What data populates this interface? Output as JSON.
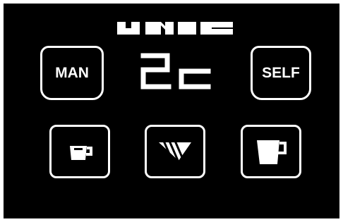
{
  "brand": {
    "logo_text": "UNIC"
  },
  "display": {
    "value": "2c"
  },
  "keys": {
    "manual_label": "MAN",
    "self_label": "SELF"
  },
  "icons": {
    "small_cup": "small-cup-icon",
    "fill": "flow-stripes-icon",
    "large_cup": "large-cup-icon"
  },
  "colors": {
    "background": "#000000",
    "foreground": "#ffffff"
  }
}
